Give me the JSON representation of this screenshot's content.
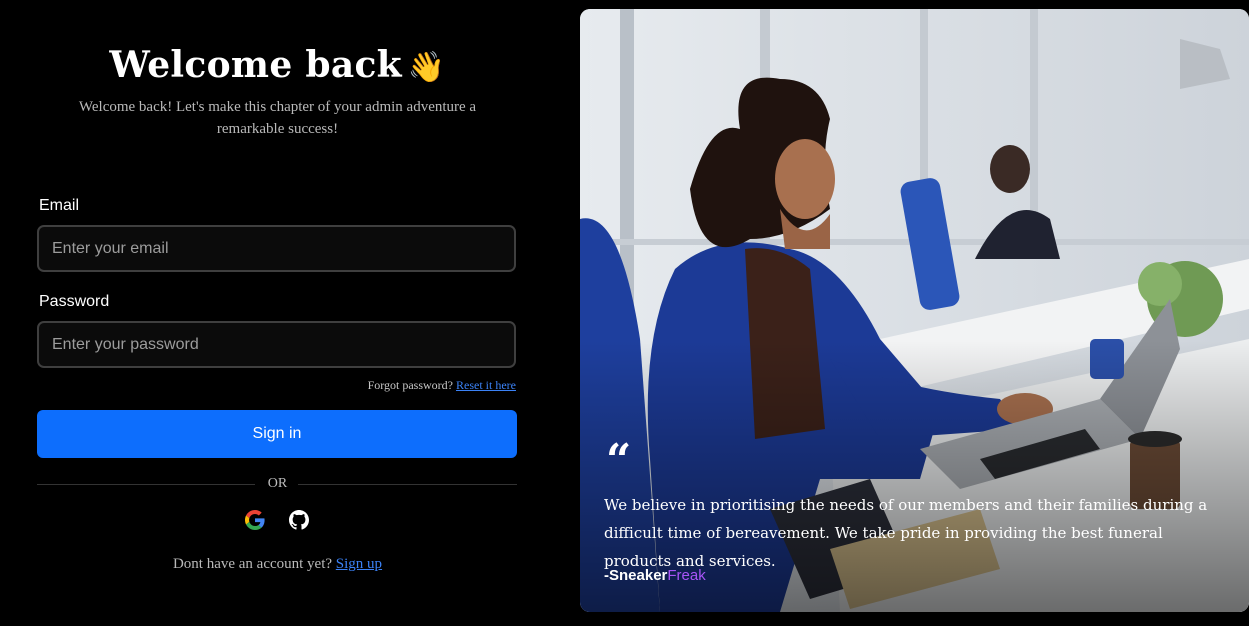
{
  "heading": {
    "title": "Welcome back",
    "emoji": "👋",
    "subtitle": "Welcome back! Let's make this chapter of your admin adventure a remarkable success!"
  },
  "form": {
    "email_label": "Email",
    "email_placeholder": "Enter your email",
    "password_label": "Password",
    "password_placeholder": "Enter your password",
    "forgot_text": "Forgot password?",
    "reset_link": "Reset it here",
    "signin_label": "Sign in",
    "or_text": "OR"
  },
  "social": [
    {
      "icon": "google-icon"
    },
    {
      "icon": "github-icon"
    }
  ],
  "signup": {
    "text": "Dont have an account yet?",
    "link": "Sign up"
  },
  "testimonial": {
    "quote": "We believe in prioritising the needs of our members and their families during a difficult time of bereavement. We take pride in providing the best funeral products and services.",
    "author_prefix": "-Sneaker",
    "author_suffix": "Freak"
  },
  "colors": {
    "primary": "#0d6efd",
    "link": "#3b82f6",
    "accent": "#a855f7",
    "background": "#000000"
  }
}
